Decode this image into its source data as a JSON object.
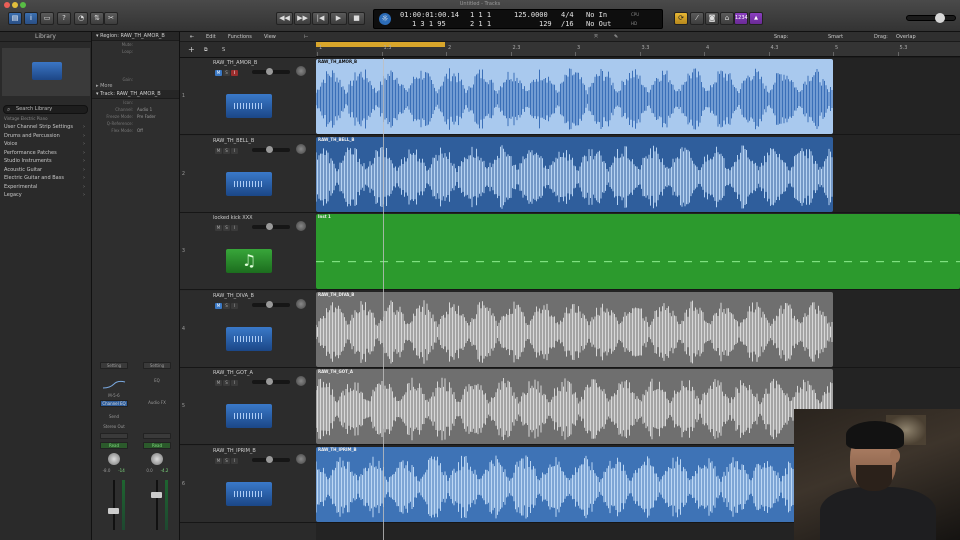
{
  "window": {
    "title": "Untitled - Tracks"
  },
  "transport": {
    "time": "01:00:01:00.14",
    "time_sub": "1 3 1  95",
    "bars": "1  1  1",
    "bars_sub": "2  1  1",
    "bars_sub2": "1",
    "tempo": "125.0000",
    "tempo_sub": "129",
    "signature": "4/4",
    "division": "/16",
    "in": "No In",
    "out": "No Out",
    "cpu_label": "CPU",
    "hd_label": "HD",
    "buttons": [
      "rewind",
      "fast-forward",
      "go-to-start",
      "play",
      "stop",
      "record"
    ]
  },
  "toolbar_right": {
    "count_in": "1234"
  },
  "library": {
    "title": "Library",
    "search_placeholder": "Search Library",
    "preset": "Vintage Electric Piano",
    "items": [
      "User Channel Strip Settings",
      "Drums and Percussion",
      "Voice",
      "Performance Patches",
      "Studio Instruments",
      "Acoustic Guitar",
      "Electric Guitar and Bass",
      "Experimental",
      "Legacy"
    ]
  },
  "inspector": {
    "region_header": "Region: RAW_TH_AMOR_B",
    "region_rows": [
      {
        "k": "Mute:",
        "v": ""
      },
      {
        "k": "Loop:",
        "v": ""
      },
      {
        "k": "",
        "v": ""
      },
      {
        "k": "",
        "v": ""
      },
      {
        "k": "",
        "v": ""
      },
      {
        "k": "Gain:",
        "v": ""
      }
    ],
    "more_label": "More",
    "track_header": "Track:  RAW_TH_AMOR_B",
    "track_rows": [
      {
        "k": "Icon:",
        "v": ""
      },
      {
        "k": "Channel:",
        "v": "Audio 1"
      },
      {
        "k": "Freeze Mode:",
        "v": "Pre Fader"
      },
      {
        "k": "Q-Reference:",
        "v": ""
      },
      {
        "k": "Flex Mode:",
        "v": "Off"
      }
    ],
    "strip_a": {
      "setting": "Setting",
      "eq": "EQ",
      "input": "M-5-6",
      "bus": "Channel EQ",
      "send": "Send",
      "output": "Stereo Out",
      "mode": "Read",
      "vol": "-8.0",
      "peak": "-14"
    },
    "strip_b": {
      "setting": "Setting",
      "eq": "EQ",
      "bus": "Audio FX",
      "mode": "Read",
      "vol": "0.0",
      "peak": "-4.2"
    }
  },
  "menus": {
    "edit": "Edit",
    "functions": "Functions",
    "view": "View",
    "snap_label": "Snap:",
    "snap_value": "Smart",
    "drag_label": "Drag:",
    "drag_value": "Overlap"
  },
  "ruler": {
    "ticks": [
      "1",
      "1.3",
      "2",
      "2.3",
      "3",
      "3.3",
      "4",
      "4.3",
      "5",
      "5.3"
    ]
  },
  "tracks": [
    {
      "num": "1",
      "name": "RAW_TH_AMOR_B",
      "kind": "audio",
      "mute": true,
      "solo": false,
      "rec": true
    },
    {
      "num": "2",
      "name": "RAW_TH_BELL_B",
      "kind": "audio",
      "mute": false,
      "solo": false,
      "rec": false
    },
    {
      "num": "3",
      "name": "locked kick XXX",
      "kind": "midi",
      "mute": false,
      "solo": false,
      "rec": false
    },
    {
      "num": "4",
      "name": "RAW_TH_DIVA_B",
      "kind": "audio",
      "mute": true,
      "solo": false,
      "rec": false
    },
    {
      "num": "5",
      "name": "RAW_TH_GOT_A",
      "kind": "audio",
      "mute": false,
      "solo": false,
      "rec": false
    },
    {
      "num": "6",
      "name": "RAW_TH_IPRIM_B",
      "kind": "audio",
      "mute": false,
      "solo": false,
      "rec": false
    }
  ],
  "regions": [
    {
      "name": "RAW_TH_AMOR_B",
      "style": "light"
    },
    {
      "name": "RAW_TH_BELL_B",
      "style": "dark"
    },
    {
      "name": "Inst 1",
      "style": "green"
    },
    {
      "name": "RAW_TH_DIVA_B",
      "style": "gray"
    },
    {
      "name": "RAW_TH_GOT_A",
      "style": "gray"
    },
    {
      "name": "RAW_TH_IPRIM_B",
      "style": "blue"
    }
  ],
  "colors": {
    "cycle": "#d9a62b",
    "audio_light": "#a9c9ee",
    "audio_dark": "#2f5e9c",
    "midi": "#2c9a2d",
    "audio_gray": "#6f6f6f"
  }
}
